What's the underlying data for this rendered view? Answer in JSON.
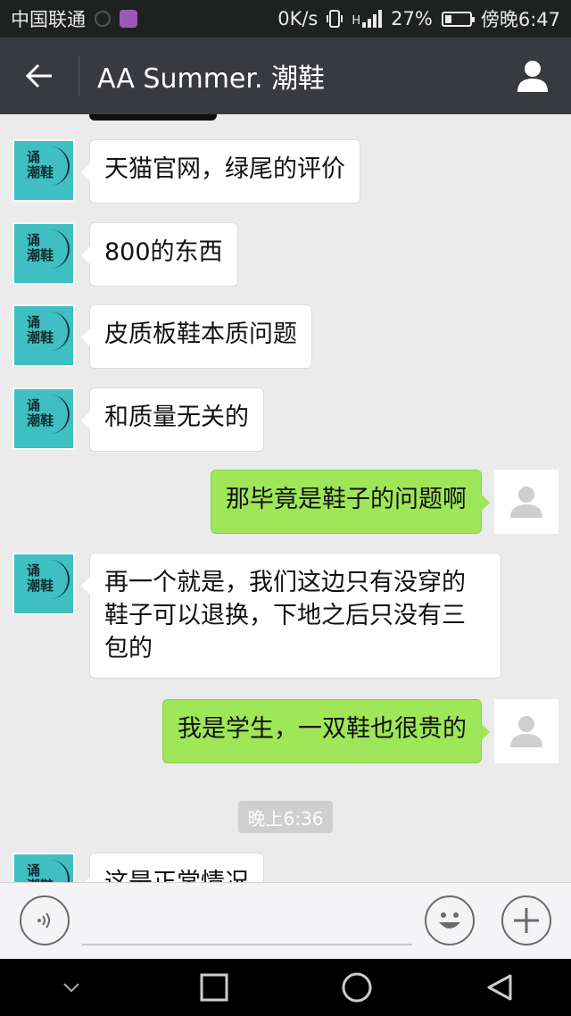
{
  "status_bar": {
    "carrier": "中国联通",
    "speed": "0K/s",
    "network": "H",
    "battery_percent": "27%",
    "battery_level": 0.27,
    "time": "傍晚6:47"
  },
  "title_bar": {
    "title": "AA Summer. 潮鞋",
    "back_icon": "arrow-left-icon",
    "profile_icon": "person-icon"
  },
  "shop_avatar_text": "诵\n潮鞋",
  "messages": [
    {
      "side": "left",
      "text": "天猫官网，绿尾的评价"
    },
    {
      "side": "left",
      "text": "800的东西"
    },
    {
      "side": "left",
      "text": "皮质板鞋本质问题"
    },
    {
      "side": "left",
      "text": "和质量无关的"
    },
    {
      "side": "right",
      "text": "那毕竟是鞋子的问题啊"
    },
    {
      "side": "left",
      "text": "再一个就是，我们这边只有没穿的鞋子可以退换，下地之后只没有三包的"
    },
    {
      "side": "right",
      "text": "我是学生，一双鞋也很贵的"
    },
    {
      "side": "left",
      "text": "这是正常情况"
    }
  ],
  "timestamp": "晚上6:36",
  "input_bar": {
    "voice_icon": "voice-icon",
    "emoji_icon": "emoji-icon",
    "plus_icon": "plus-icon"
  },
  "nav_bar": {
    "down_icon": "chevron-down-icon",
    "recent_icon": "square-icon",
    "home_icon": "circle-icon",
    "back_icon": "triangle-back-icon"
  },
  "colors": {
    "title_bar": "#393a3f",
    "status_bar": "#1f2121",
    "chat_bg": "#ebebeb",
    "sent_bubble": "#9fe659",
    "received_bubble": "#ffffff",
    "shop_avatar": "#3fbfc2"
  }
}
